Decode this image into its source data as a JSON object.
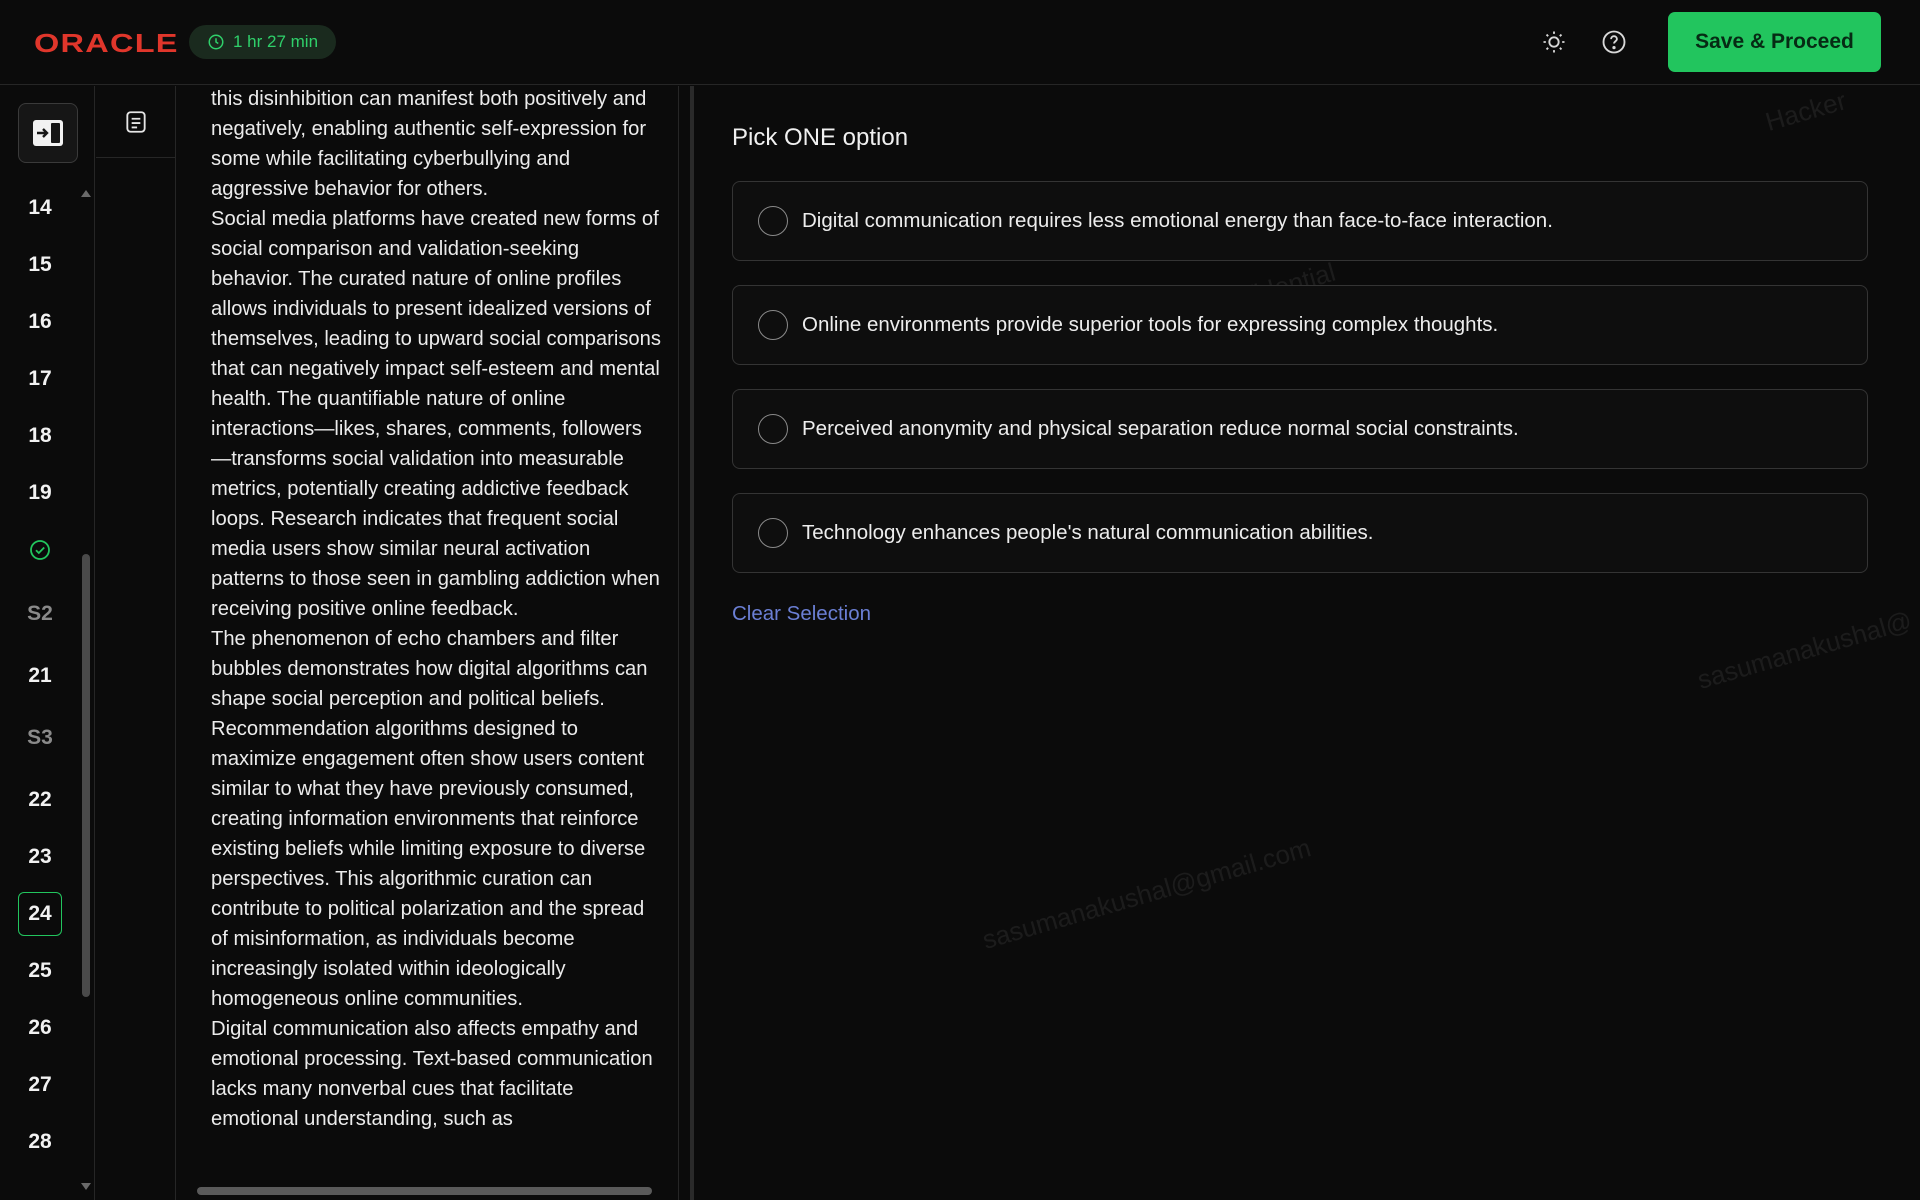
{
  "header": {
    "logo": "ORACLE",
    "timer": "1 hr 27 min",
    "save_label": "Save & Proceed",
    "theme_icon": "sun-icon",
    "help_icon": "help-circle-icon"
  },
  "nav": {
    "toggle_icon": "panel-toggle-icon",
    "items": [
      {
        "label": "14",
        "type": "question"
      },
      {
        "label": "15",
        "type": "question"
      },
      {
        "label": "16",
        "type": "question"
      },
      {
        "label": "17",
        "type": "question"
      },
      {
        "label": "18",
        "type": "question"
      },
      {
        "label": "19",
        "type": "question"
      },
      {
        "label": "",
        "type": "answered",
        "icon": "check-circle-icon"
      },
      {
        "label": "S2",
        "type": "section"
      },
      {
        "label": "21",
        "type": "question"
      },
      {
        "label": "S3",
        "type": "section"
      },
      {
        "label": "22",
        "type": "question"
      },
      {
        "label": "23",
        "type": "question"
      },
      {
        "label": "24",
        "type": "current"
      },
      {
        "label": "25",
        "type": "question"
      },
      {
        "label": "26",
        "type": "question"
      },
      {
        "label": "27",
        "type": "question"
      },
      {
        "label": "28",
        "type": "question"
      }
    ]
  },
  "tool": {
    "icon": "notes-icon"
  },
  "passage": {
    "paragraphs": [
      "this disinhibition can manifest both positively and negatively, enabling authentic self-expression for some while facilitating cyberbullying and aggressive behavior for others.",
      "Social media platforms have created new forms of social comparison and validation-seeking behavior. The curated nature of online profiles allows individuals to present idealized versions of themselves, leading to upward social comparisons that can negatively impact self-esteem and mental health. The quantifiable nature of online interactions—likes, shares, comments, followers—transforms social validation into measurable metrics, potentially creating addictive feedback loops. Research indicates that frequent social media users show similar neural activation patterns to those seen in gambling addiction when receiving positive online feedback.",
      "The phenomenon of echo chambers and filter bubbles demonstrates how digital algorithms can shape social perception and political beliefs. Recommendation algorithms designed to maximize engagement often show users content similar to what they have previously consumed, creating information environments that reinforce existing beliefs while limiting exposure to diverse perspectives. This algorithmic curation can contribute to political polarization and the spread of misinformation, as individuals become increasingly isolated within ideologically homogeneous online communities.",
      "Digital communication also affects empathy and emotional processing. Text-based communication lacks many nonverbal cues that facilitate emotional understanding, such as"
    ]
  },
  "question": {
    "prompt": "Pick ONE option",
    "options": [
      "Digital communication requires less emotional energy than face-to-face interaction.",
      "Online environments provide superior tools for expressing complex thoughts.",
      "Perceived anonymity and physical separation reduce normal social constraints.",
      "Technology enhances people's natural communication abilities."
    ],
    "clear_label": "Clear Selection"
  },
  "watermarks": {
    "confidential": "HackerRank Confidential",
    "email": "sasumanakushal@gmail.com",
    "corner_top": "Hacker",
    "corner_right": "sasumanakushal@"
  },
  "colors": {
    "accent": "#22c55e",
    "brand": "#e0362b",
    "link": "#6b7fd4",
    "background": "#0b0b0b"
  }
}
